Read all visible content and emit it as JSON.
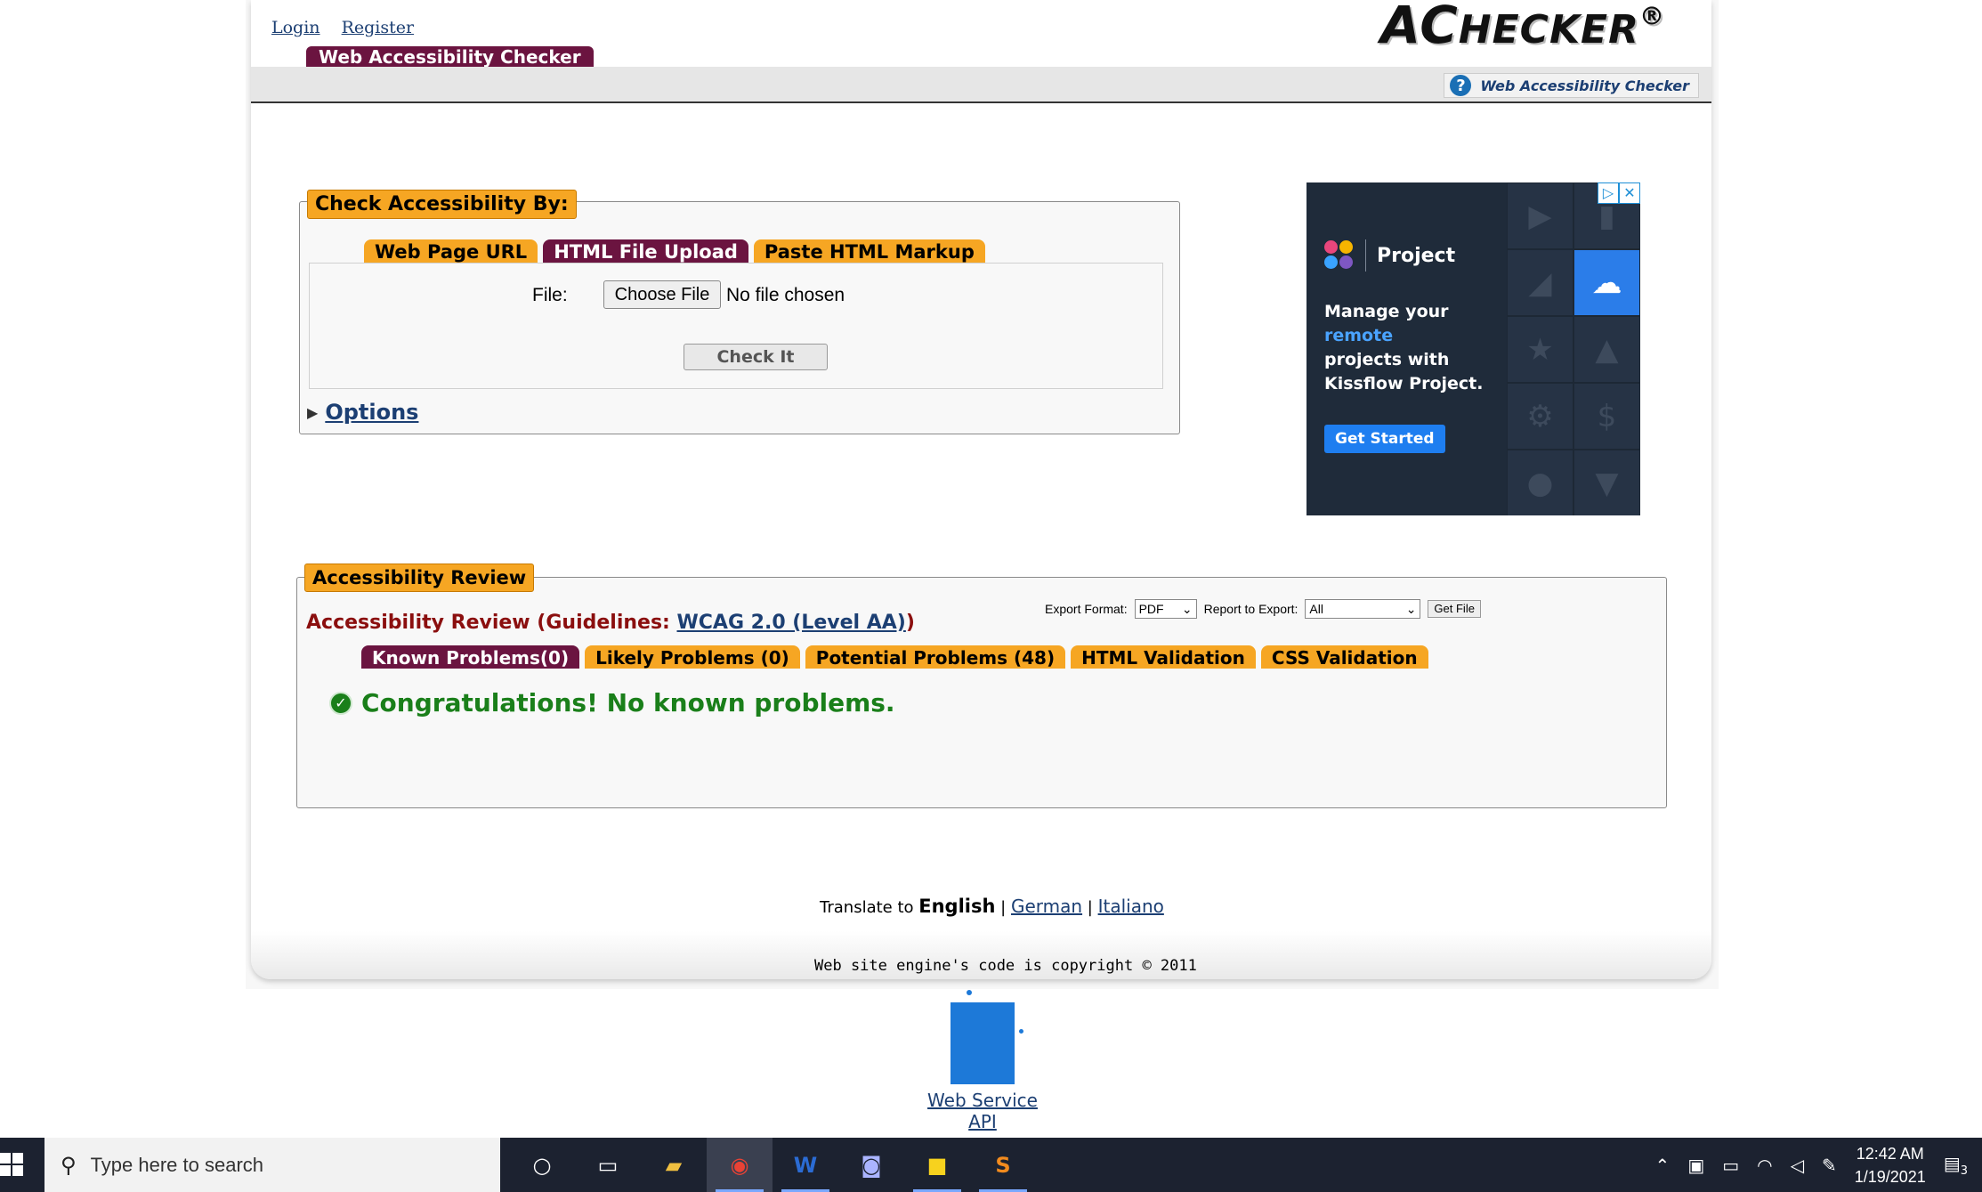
{
  "header": {
    "login": "Login",
    "register": "Register",
    "logo_a": "AC",
    "logo_b": "HECKER",
    "logo_reg": "®",
    "site_tab": "Web Accessibility Checker",
    "help_link": "Web Accessibility Checker"
  },
  "check": {
    "legend": "Check Accessibility By:",
    "tabs": [
      "Web Page URL",
      "HTML File Upload",
      "Paste HTML Markup"
    ],
    "active_tab": "HTML File Upload",
    "file_label": "File:",
    "choose_file": "Choose File",
    "no_file": "No file chosen",
    "check_it": "Check It",
    "options": "Options"
  },
  "ad": {
    "brand": "Project",
    "line1": "Manage your",
    "line2": "remote",
    "line3": "projects with",
    "line4": "Kissflow Project.",
    "cta": "Get Started"
  },
  "review": {
    "legend": "Accessibility Review",
    "title_prefix": "Accessibility Review (Guidelines: ",
    "guideline_link": "WCAG 2.0 (Level AA)",
    "title_suffix": ")",
    "export_format_label": "Export Format:",
    "export_format_value": "PDF",
    "report_label": "Report to Export:",
    "report_value": "All",
    "get_file": "Get File",
    "tabs": [
      "Known Problems(0)",
      "Likely Problems (0)",
      "Potential Problems (48)",
      "HTML Validation",
      "CSS Validation"
    ],
    "active_tab": "Known Problems(0)",
    "congrats": "Congratulations! No known problems."
  },
  "footer": {
    "translate_label": "Translate to",
    "lang_current": "English",
    "lang_german": "German",
    "lang_italiano": "Italiano",
    "copyright": "Web site engine's code is copyright © 2011",
    "api_link": "Web Service API"
  },
  "taskbar": {
    "search_placeholder": "Type here to search",
    "time": "12:42 AM",
    "date": "1/19/2021",
    "notifications": "3"
  },
  "colors": {
    "tab_orange": "#f6a623",
    "tab_active": "#6b1440",
    "link": "#1c3f73",
    "success": "#1a7f1a",
    "review_title": "#8b0f0f"
  }
}
